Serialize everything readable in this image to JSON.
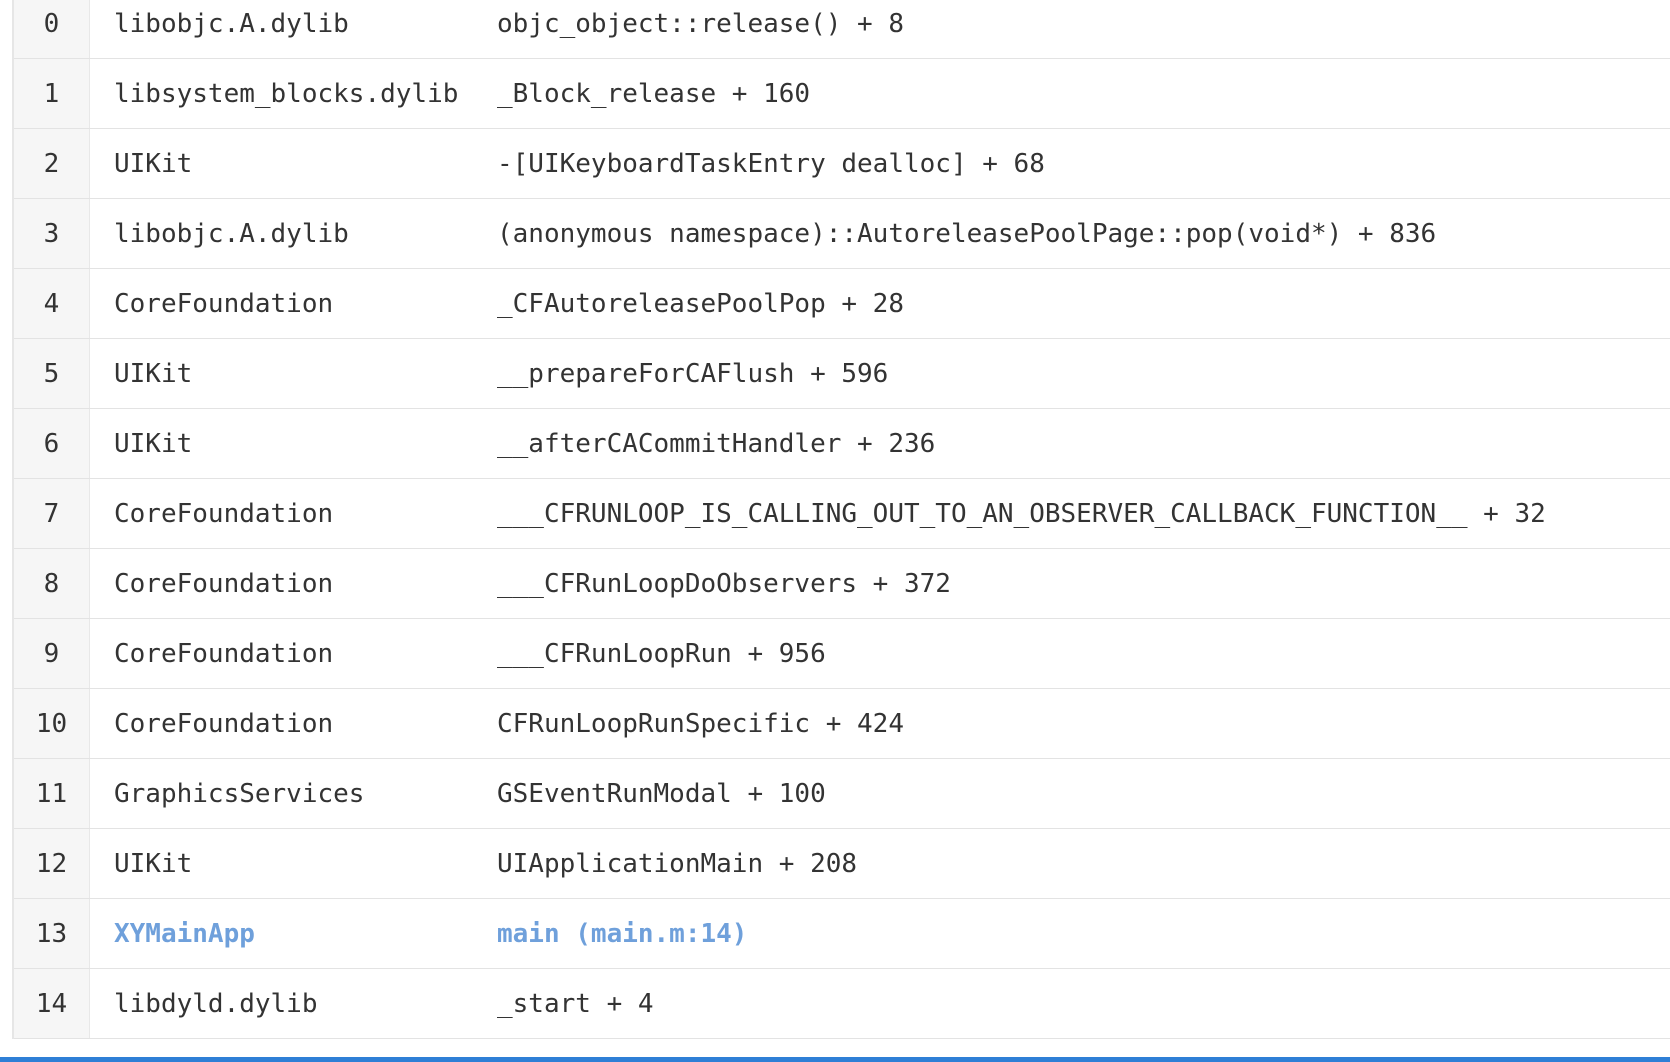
{
  "frames": [
    {
      "index": "0",
      "module": "libobjc.A.dylib",
      "symbol": "objc_object::release() + 8",
      "highlight": false
    },
    {
      "index": "1",
      "module": "libsystem_blocks.dylib",
      "symbol": "_Block_release + 160",
      "highlight": false
    },
    {
      "index": "2",
      "module": "UIKit",
      "symbol": "-[UIKeyboardTaskEntry dealloc] + 68",
      "highlight": false
    },
    {
      "index": "3",
      "module": "libobjc.A.dylib",
      "symbol": "(anonymous namespace)::AutoreleasePoolPage::pop(void*) + 836",
      "highlight": false
    },
    {
      "index": "4",
      "module": "CoreFoundation",
      "symbol": "_CFAutoreleasePoolPop + 28",
      "highlight": false
    },
    {
      "index": "5",
      "module": "UIKit",
      "symbol": "__prepareForCAFlush + 596",
      "highlight": false
    },
    {
      "index": "6",
      "module": "UIKit",
      "symbol": "__afterCACommitHandler + 236",
      "highlight": false
    },
    {
      "index": "7",
      "module": "CoreFoundation",
      "symbol": "___CFRUNLOOP_IS_CALLING_OUT_TO_AN_OBSERVER_CALLBACK_FUNCTION__ + 32",
      "highlight": false
    },
    {
      "index": "8",
      "module": "CoreFoundation",
      "symbol": "___CFRunLoopDoObservers + 372",
      "highlight": false
    },
    {
      "index": "9",
      "module": "CoreFoundation",
      "symbol": "___CFRunLoopRun + 956",
      "highlight": false
    },
    {
      "index": "10",
      "module": "CoreFoundation",
      "symbol": "CFRunLoopRunSpecific + 424",
      "highlight": false
    },
    {
      "index": "11",
      "module": "GraphicsServices",
      "symbol": "GSEventRunModal + 100",
      "highlight": false
    },
    {
      "index": "12",
      "module": "UIKit",
      "symbol": "UIApplicationMain + 208",
      "highlight": false
    },
    {
      "index": "13",
      "module": "XYMainApp",
      "symbol": "main (main.m:14)",
      "highlight": true
    },
    {
      "index": "14",
      "module": "libdyld.dylib",
      "symbol": "_start + 4",
      "highlight": false
    }
  ],
  "colors": {
    "highlight_text": "#6fa0db",
    "accent_rule": "#2f7fd6"
  }
}
